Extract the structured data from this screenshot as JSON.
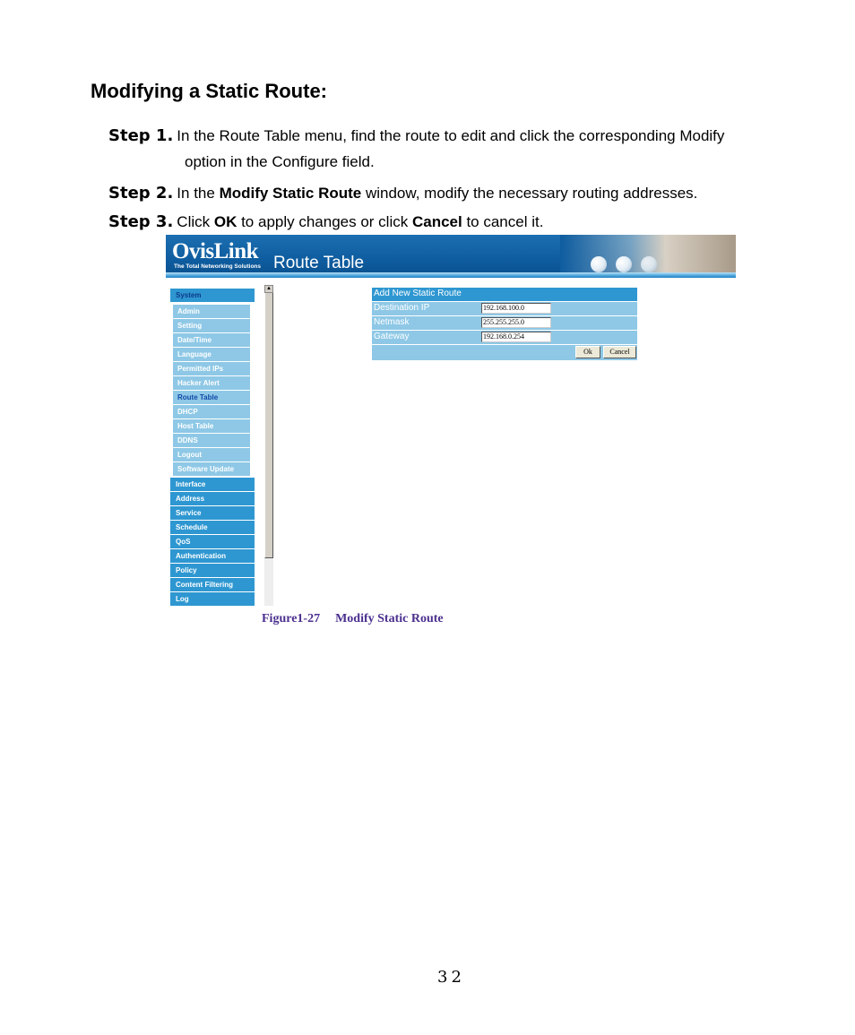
{
  "doc": {
    "heading": "Modifying a Static Route:",
    "steps": [
      {
        "label": "Step 1.",
        "parts": [
          {
            "t": "In the Route Table menu, find the route to edit and click the corresponding Modify",
            "b": false
          }
        ],
        "cont": "option in the Configure field."
      },
      {
        "label": "Step 2.",
        "parts": [
          {
            "t": "In the ",
            "b": false
          },
          {
            "t": "Modify Static Route",
            "b": true
          },
          {
            "t": " window, modify the necessary routing addresses.",
            "b": false
          }
        ]
      },
      {
        "label": "Step 3.",
        "parts": [
          {
            "t": "Click ",
            "b": false
          },
          {
            "t": "OK",
            "b": true
          },
          {
            "t": " to apply changes or click ",
            "b": false
          },
          {
            "t": "Cancel",
            "b": true
          },
          {
            "t": " to cancel it.",
            "b": false
          }
        ]
      }
    ],
    "caption_num": "Figure1-27",
    "caption_text": "Modify Static Route",
    "page_number": "32"
  },
  "screenshot": {
    "logo": "OvisLink",
    "tagline": "The Total Networking Solutions",
    "title": "Route Table",
    "sidebar": {
      "system_label": "System",
      "system_items": [
        "Admin",
        "Setting",
        "Date/Time",
        "Language",
        "Permitted IPs",
        "Hacker Alert",
        "Route Table",
        "DHCP",
        "Host Table",
        "DDNS",
        "Logout",
        "Software Update"
      ],
      "active_item": "Route Table",
      "sections": [
        "Interface",
        "Address",
        "Service",
        "Schedule",
        "QoS",
        "Authentication",
        "Policy",
        "Content Filtering",
        "Log"
      ]
    },
    "form": {
      "title": "Add New Static Route",
      "fields": [
        {
          "label": "Destination IP",
          "value": "192.168.100.0"
        },
        {
          "label": "Netmask",
          "value": "255.255.255.0"
        },
        {
          "label": "Gateway",
          "value": "192.168.0.254"
        }
      ],
      "ok_label": "Ok",
      "cancel_label": "Cancel"
    },
    "colors": {
      "header_blue": "#2e97d1",
      "row_blue": "#8ec8e6",
      "caption_purple": "#4b2f8f"
    }
  }
}
